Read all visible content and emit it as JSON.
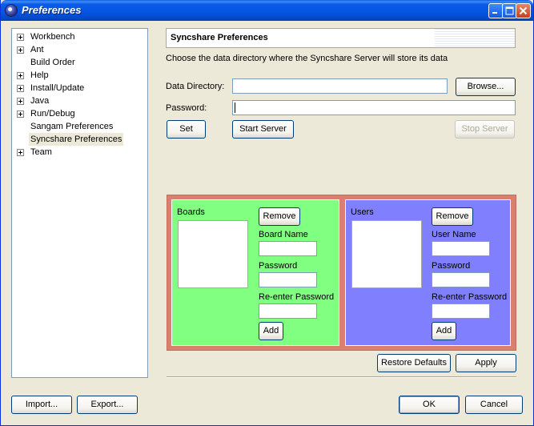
{
  "window": {
    "title": "Preferences"
  },
  "tree": {
    "items": [
      {
        "label": "Workbench",
        "expandable": true,
        "selected": false
      },
      {
        "label": "Ant",
        "expandable": true,
        "selected": false
      },
      {
        "label": "Build Order",
        "expandable": false,
        "selected": false
      },
      {
        "label": "Help",
        "expandable": true,
        "selected": false
      },
      {
        "label": "Install/Update",
        "expandable": true,
        "selected": false
      },
      {
        "label": "Java",
        "expandable": true,
        "selected": false
      },
      {
        "label": "Run/Debug",
        "expandable": true,
        "selected": false
      },
      {
        "label": "Sangam Preferences",
        "expandable": false,
        "selected": false
      },
      {
        "label": "Syncshare Preferences",
        "expandable": false,
        "selected": true
      },
      {
        "label": "Team",
        "expandable": true,
        "selected": false
      }
    ]
  },
  "page": {
    "title": "Syncshare Preferences",
    "description": "Choose the data directory where the Syncshare Server will store its data",
    "data_directory_label": "Data Directory:",
    "data_directory_value": "",
    "browse_label": "Browse...",
    "password_label": "Password:",
    "password_value": "",
    "set_label": "Set",
    "start_server_label": "Start Server",
    "stop_server_label": "Stop Server"
  },
  "boards": {
    "title": "Boards",
    "remove_label": "Remove",
    "name_label": "Board Name",
    "password_label": "Password",
    "reenter_label": "Re-enter Password",
    "add_label": "Add",
    "bg_color": "#80ff80"
  },
  "users": {
    "title": "Users",
    "remove_label": "Remove",
    "name_label": "User Name",
    "password_label": "Password",
    "reenter_label": "Re-enter Password",
    "add_label": "Add",
    "bg_color": "#8080ff"
  },
  "frame_color": "#d98070",
  "footer": {
    "restore_defaults_label": "Restore Defaults",
    "apply_label": "Apply",
    "import_label": "Import...",
    "export_label": "Export...",
    "ok_label": "OK",
    "cancel_label": "Cancel"
  }
}
